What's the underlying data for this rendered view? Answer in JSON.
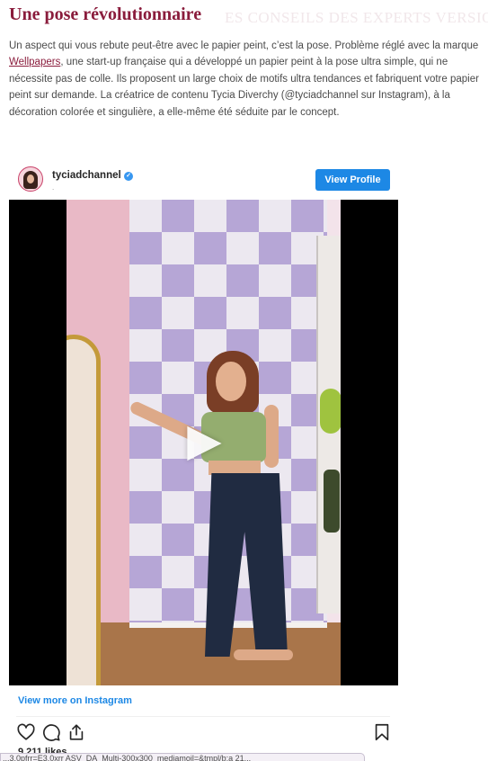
{
  "article": {
    "ghost_heading": "ES CONSEILS DES EXPERTS VERSIO",
    "title": "Une pose révolutionnaire",
    "para_before_link": "Un aspect qui vous rebute peut-être avec le papier peint, c’est la pose. Problème réglé avec la marque ",
    "link_text": "Wellpapers",
    "para_after_link": ", une start-up française qui a développé un papier peint à la pose ultra simple, qui ne nécessite pas de colle. Ils proposent un large choix de motifs ultra tendances et fabriquent votre papier peint sur demande. La créatrice de contenu Tycia Diverchy (@tyciadchannel sur Instagram), à la décoration colorée et singulière, a elle-même été séduite par le concept."
  },
  "embed": {
    "username": "tyciadchannel",
    "subtext": ".",
    "view_profile_label": "View Profile",
    "play_glyph": "▶",
    "view_more_label": "View more on Instagram",
    "likes_text": "9 211 likes",
    "icons": [
      "heart-icon",
      "comment-icon",
      "share-icon",
      "bookmark-icon",
      "verified-badge-icon",
      "play-icon"
    ],
    "verified_glyph": "✓"
  },
  "status_bar": {
    "url_text": "...3.0pfrr=E3.0xrr ASV_DA_Multi-300x300_mediamoil=&tmpl/b:a 21..."
  },
  "colors": {
    "title": "#8a1c3c",
    "button_blue": "#1d88e5",
    "verified_blue": "#3897f0",
    "checker_lilac": "#b6a6d6"
  }
}
